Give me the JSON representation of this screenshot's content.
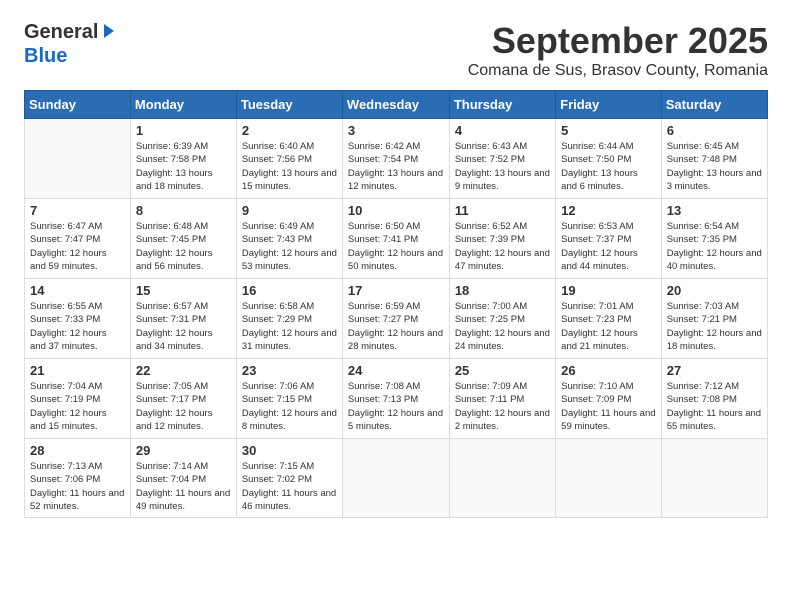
{
  "header": {
    "logo_general": "General",
    "logo_blue": "Blue",
    "month_title": "September 2025",
    "location": "Comana de Sus, Brasov County, Romania"
  },
  "days_of_week": [
    "Sunday",
    "Monday",
    "Tuesday",
    "Wednesday",
    "Thursday",
    "Friday",
    "Saturday"
  ],
  "weeks": [
    [
      {
        "day": "",
        "info": ""
      },
      {
        "day": "1",
        "info": "Sunrise: 6:39 AM\nSunset: 7:58 PM\nDaylight: 13 hours\nand 18 minutes."
      },
      {
        "day": "2",
        "info": "Sunrise: 6:40 AM\nSunset: 7:56 PM\nDaylight: 13 hours\nand 15 minutes."
      },
      {
        "day": "3",
        "info": "Sunrise: 6:42 AM\nSunset: 7:54 PM\nDaylight: 13 hours\nand 12 minutes."
      },
      {
        "day": "4",
        "info": "Sunrise: 6:43 AM\nSunset: 7:52 PM\nDaylight: 13 hours\nand 9 minutes."
      },
      {
        "day": "5",
        "info": "Sunrise: 6:44 AM\nSunset: 7:50 PM\nDaylight: 13 hours\nand 6 minutes."
      },
      {
        "day": "6",
        "info": "Sunrise: 6:45 AM\nSunset: 7:48 PM\nDaylight: 13 hours\nand 3 minutes."
      }
    ],
    [
      {
        "day": "7",
        "info": "Sunrise: 6:47 AM\nSunset: 7:47 PM\nDaylight: 12 hours\nand 59 minutes."
      },
      {
        "day": "8",
        "info": "Sunrise: 6:48 AM\nSunset: 7:45 PM\nDaylight: 12 hours\nand 56 minutes."
      },
      {
        "day": "9",
        "info": "Sunrise: 6:49 AM\nSunset: 7:43 PM\nDaylight: 12 hours\nand 53 minutes."
      },
      {
        "day": "10",
        "info": "Sunrise: 6:50 AM\nSunset: 7:41 PM\nDaylight: 12 hours\nand 50 minutes."
      },
      {
        "day": "11",
        "info": "Sunrise: 6:52 AM\nSunset: 7:39 PM\nDaylight: 12 hours\nand 47 minutes."
      },
      {
        "day": "12",
        "info": "Sunrise: 6:53 AM\nSunset: 7:37 PM\nDaylight: 12 hours\nand 44 minutes."
      },
      {
        "day": "13",
        "info": "Sunrise: 6:54 AM\nSunset: 7:35 PM\nDaylight: 12 hours\nand 40 minutes."
      }
    ],
    [
      {
        "day": "14",
        "info": "Sunrise: 6:55 AM\nSunset: 7:33 PM\nDaylight: 12 hours\nand 37 minutes."
      },
      {
        "day": "15",
        "info": "Sunrise: 6:57 AM\nSunset: 7:31 PM\nDaylight: 12 hours\nand 34 minutes."
      },
      {
        "day": "16",
        "info": "Sunrise: 6:58 AM\nSunset: 7:29 PM\nDaylight: 12 hours\nand 31 minutes."
      },
      {
        "day": "17",
        "info": "Sunrise: 6:59 AM\nSunset: 7:27 PM\nDaylight: 12 hours\nand 28 minutes."
      },
      {
        "day": "18",
        "info": "Sunrise: 7:00 AM\nSunset: 7:25 PM\nDaylight: 12 hours\nand 24 minutes."
      },
      {
        "day": "19",
        "info": "Sunrise: 7:01 AM\nSunset: 7:23 PM\nDaylight: 12 hours\nand 21 minutes."
      },
      {
        "day": "20",
        "info": "Sunrise: 7:03 AM\nSunset: 7:21 PM\nDaylight: 12 hours\nand 18 minutes."
      }
    ],
    [
      {
        "day": "21",
        "info": "Sunrise: 7:04 AM\nSunset: 7:19 PM\nDaylight: 12 hours\nand 15 minutes."
      },
      {
        "day": "22",
        "info": "Sunrise: 7:05 AM\nSunset: 7:17 PM\nDaylight: 12 hours\nand 12 minutes."
      },
      {
        "day": "23",
        "info": "Sunrise: 7:06 AM\nSunset: 7:15 PM\nDaylight: 12 hours\nand 8 minutes."
      },
      {
        "day": "24",
        "info": "Sunrise: 7:08 AM\nSunset: 7:13 PM\nDaylight: 12 hours\nand 5 minutes."
      },
      {
        "day": "25",
        "info": "Sunrise: 7:09 AM\nSunset: 7:11 PM\nDaylight: 12 hours\nand 2 minutes."
      },
      {
        "day": "26",
        "info": "Sunrise: 7:10 AM\nSunset: 7:09 PM\nDaylight: 11 hours\nand 59 minutes."
      },
      {
        "day": "27",
        "info": "Sunrise: 7:12 AM\nSunset: 7:08 PM\nDaylight: 11 hours\nand 55 minutes."
      }
    ],
    [
      {
        "day": "28",
        "info": "Sunrise: 7:13 AM\nSunset: 7:06 PM\nDaylight: 11 hours\nand 52 minutes."
      },
      {
        "day": "29",
        "info": "Sunrise: 7:14 AM\nSunset: 7:04 PM\nDaylight: 11 hours\nand 49 minutes."
      },
      {
        "day": "30",
        "info": "Sunrise: 7:15 AM\nSunset: 7:02 PM\nDaylight: 11 hours\nand 46 minutes."
      },
      {
        "day": "",
        "info": ""
      },
      {
        "day": "",
        "info": ""
      },
      {
        "day": "",
        "info": ""
      },
      {
        "day": "",
        "info": ""
      }
    ]
  ]
}
